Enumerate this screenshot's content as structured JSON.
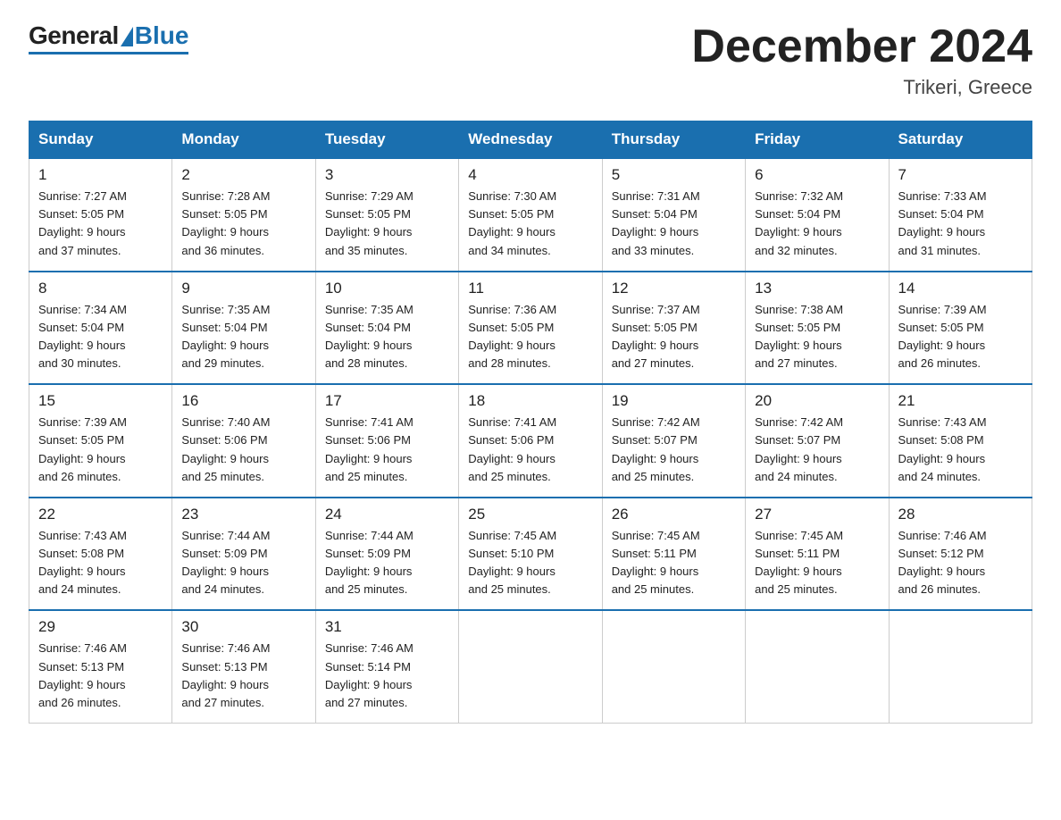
{
  "header": {
    "logo_general": "General",
    "logo_blue": "Blue",
    "month_title": "December 2024",
    "location": "Trikeri, Greece"
  },
  "weekdays": [
    "Sunday",
    "Monday",
    "Tuesday",
    "Wednesday",
    "Thursday",
    "Friday",
    "Saturday"
  ],
  "weeks": [
    [
      {
        "day": "1",
        "sunrise": "7:27 AM",
        "sunset": "5:05 PM",
        "daylight": "9 hours and 37 minutes."
      },
      {
        "day": "2",
        "sunrise": "7:28 AM",
        "sunset": "5:05 PM",
        "daylight": "9 hours and 36 minutes."
      },
      {
        "day": "3",
        "sunrise": "7:29 AM",
        "sunset": "5:05 PM",
        "daylight": "9 hours and 35 minutes."
      },
      {
        "day": "4",
        "sunrise": "7:30 AM",
        "sunset": "5:05 PM",
        "daylight": "9 hours and 34 minutes."
      },
      {
        "day": "5",
        "sunrise": "7:31 AM",
        "sunset": "5:04 PM",
        "daylight": "9 hours and 33 minutes."
      },
      {
        "day": "6",
        "sunrise": "7:32 AM",
        "sunset": "5:04 PM",
        "daylight": "9 hours and 32 minutes."
      },
      {
        "day": "7",
        "sunrise": "7:33 AM",
        "sunset": "5:04 PM",
        "daylight": "9 hours and 31 minutes."
      }
    ],
    [
      {
        "day": "8",
        "sunrise": "7:34 AM",
        "sunset": "5:04 PM",
        "daylight": "9 hours and 30 minutes."
      },
      {
        "day": "9",
        "sunrise": "7:35 AM",
        "sunset": "5:04 PM",
        "daylight": "9 hours and 29 minutes."
      },
      {
        "day": "10",
        "sunrise": "7:35 AM",
        "sunset": "5:04 PM",
        "daylight": "9 hours and 28 minutes."
      },
      {
        "day": "11",
        "sunrise": "7:36 AM",
        "sunset": "5:05 PM",
        "daylight": "9 hours and 28 minutes."
      },
      {
        "day": "12",
        "sunrise": "7:37 AM",
        "sunset": "5:05 PM",
        "daylight": "9 hours and 27 minutes."
      },
      {
        "day": "13",
        "sunrise": "7:38 AM",
        "sunset": "5:05 PM",
        "daylight": "9 hours and 27 minutes."
      },
      {
        "day": "14",
        "sunrise": "7:39 AM",
        "sunset": "5:05 PM",
        "daylight": "9 hours and 26 minutes."
      }
    ],
    [
      {
        "day": "15",
        "sunrise": "7:39 AM",
        "sunset": "5:05 PM",
        "daylight": "9 hours and 26 minutes."
      },
      {
        "day": "16",
        "sunrise": "7:40 AM",
        "sunset": "5:06 PM",
        "daylight": "9 hours and 25 minutes."
      },
      {
        "day": "17",
        "sunrise": "7:41 AM",
        "sunset": "5:06 PM",
        "daylight": "9 hours and 25 minutes."
      },
      {
        "day": "18",
        "sunrise": "7:41 AM",
        "sunset": "5:06 PM",
        "daylight": "9 hours and 25 minutes."
      },
      {
        "day": "19",
        "sunrise": "7:42 AM",
        "sunset": "5:07 PM",
        "daylight": "9 hours and 25 minutes."
      },
      {
        "day": "20",
        "sunrise": "7:42 AM",
        "sunset": "5:07 PM",
        "daylight": "9 hours and 24 minutes."
      },
      {
        "day": "21",
        "sunrise": "7:43 AM",
        "sunset": "5:08 PM",
        "daylight": "9 hours and 24 minutes."
      }
    ],
    [
      {
        "day": "22",
        "sunrise": "7:43 AM",
        "sunset": "5:08 PM",
        "daylight": "9 hours and 24 minutes."
      },
      {
        "day": "23",
        "sunrise": "7:44 AM",
        "sunset": "5:09 PM",
        "daylight": "9 hours and 24 minutes."
      },
      {
        "day": "24",
        "sunrise": "7:44 AM",
        "sunset": "5:09 PM",
        "daylight": "9 hours and 25 minutes."
      },
      {
        "day": "25",
        "sunrise": "7:45 AM",
        "sunset": "5:10 PM",
        "daylight": "9 hours and 25 minutes."
      },
      {
        "day": "26",
        "sunrise": "7:45 AM",
        "sunset": "5:11 PM",
        "daylight": "9 hours and 25 minutes."
      },
      {
        "day": "27",
        "sunrise": "7:45 AM",
        "sunset": "5:11 PM",
        "daylight": "9 hours and 25 minutes."
      },
      {
        "day": "28",
        "sunrise": "7:46 AM",
        "sunset": "5:12 PM",
        "daylight": "9 hours and 26 minutes."
      }
    ],
    [
      {
        "day": "29",
        "sunrise": "7:46 AM",
        "sunset": "5:13 PM",
        "daylight": "9 hours and 26 minutes."
      },
      {
        "day": "30",
        "sunrise": "7:46 AM",
        "sunset": "5:13 PM",
        "daylight": "9 hours and 27 minutes."
      },
      {
        "day": "31",
        "sunrise": "7:46 AM",
        "sunset": "5:14 PM",
        "daylight": "9 hours and 27 minutes."
      },
      null,
      null,
      null,
      null
    ]
  ]
}
